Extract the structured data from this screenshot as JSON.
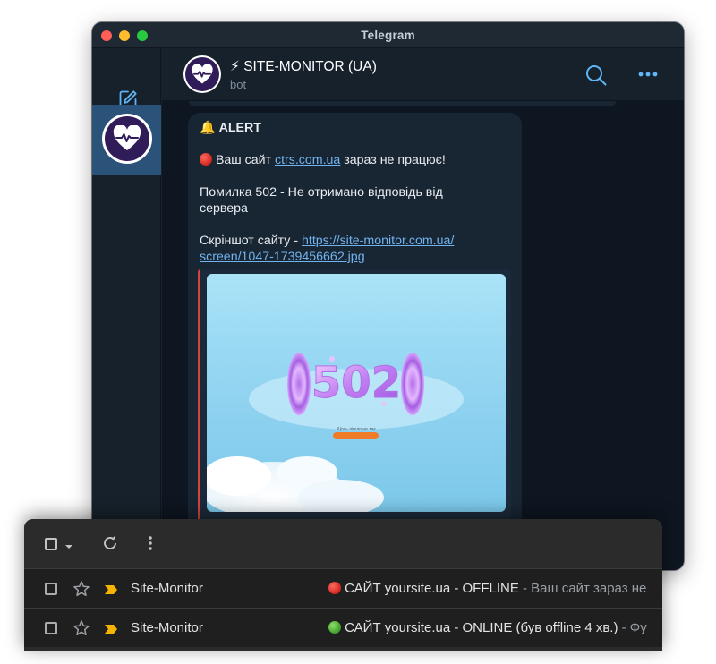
{
  "telegram": {
    "window_title": "Telegram",
    "chat": {
      "name": "⚡ SITE-MONITOR (UA)",
      "status": "bot"
    },
    "message": {
      "alert_icon": "🔔",
      "alert_title": "ALERT",
      "line1_before": "Ваш сайт ",
      "line1_link": "ctrs.com.ua",
      "line1_after": " зараз не працює!",
      "line2a": "Помилка 502 - Не отримано відповідь від",
      "line2b": "сервера",
      "line3_label": "Скріншот сайту - ",
      "line3_link_a": "https://site-monitor.com.ua/",
      "line3_link_b": "screen/1047-1739456662.jpg",
      "preview_image": {
        "headline": "502",
        "caption": "Щось пішло не так"
      }
    },
    "colors": {
      "accent": "#5eb5f7",
      "link": "#71b3ee",
      "selected_chat": "#2b5278",
      "preview_border": "#d6453b"
    }
  },
  "gmail": {
    "toolbar": {
      "select_icon": "checkbox-icon",
      "refresh_icon": "refresh-icon",
      "more_icon": "more-vert-icon"
    },
    "rows": [
      {
        "sender": "Site-Monitor",
        "status_icon": "red-circle",
        "subject": "САЙТ yoursite.ua - OFFLINE",
        "snippet": " - Ваш сайт зараз не"
      },
      {
        "sender": "Site-Monitor",
        "status_icon": "green-circle",
        "subject": "САЙТ yoursite.ua - ONLINE (був offline 4 хв.)",
        "snippet": " - Фу"
      }
    ],
    "colors": {
      "important_marker": "#f5b400"
    }
  }
}
